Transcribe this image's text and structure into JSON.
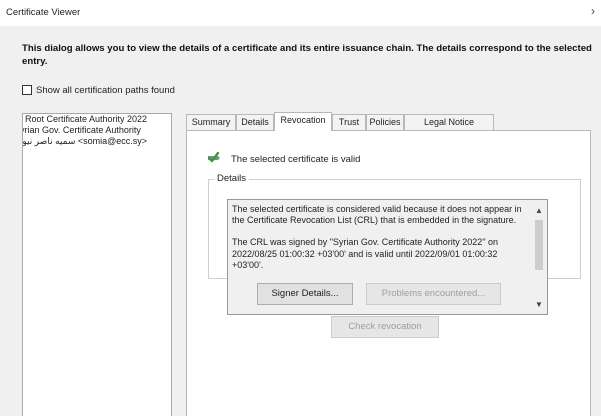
{
  "window": {
    "title": "Certificate Viewer",
    "close_glyph": "›"
  },
  "description": "This dialog allows you to view the details of a certificate and its entire issuance chain. The details correspond to the selected entry.",
  "show_all_checkbox": {
    "label": "Show all certification paths found",
    "checked": false
  },
  "chain": [
    "Root Certificate Authority 2022",
    "Syrian Gov. Certificate Authority",
    "سميه ناصر نيور <somia@ecc.sy>"
  ],
  "tabs": [
    {
      "label": "Summary"
    },
    {
      "label": "Details"
    },
    {
      "label": "Revocation"
    },
    {
      "label": "Trust"
    },
    {
      "label": "Policies"
    },
    {
      "label": "Legal Notice"
    }
  ],
  "active_tab": "Revocation",
  "status": {
    "text": "The selected certificate is valid",
    "icon": "valid-check-icon"
  },
  "details": {
    "group_label": "Details",
    "paragraph1": "The selected certificate is considered valid because it does not appear in the Certificate Revocation List (CRL) that is embedded in the signature.",
    "paragraph2": "The CRL was signed by \"Syrian Gov. Certificate Authority 2022\" on 2022/08/25 01:00:32 +03'00' and is valid until 2022/09/01 01:00:32 +03'00'."
  },
  "buttons": {
    "signer_details": "Signer Details...",
    "problems": "Problems encountered...",
    "check_revocation": "Check revocation"
  },
  "colors": {
    "dialog_bg": "#f0f0f0",
    "panel_bg": "#ffffff",
    "disabled_text": "#9e9e9e",
    "icon_green": "#3c9a3c",
    "icon_gray": "#7a8a99"
  }
}
